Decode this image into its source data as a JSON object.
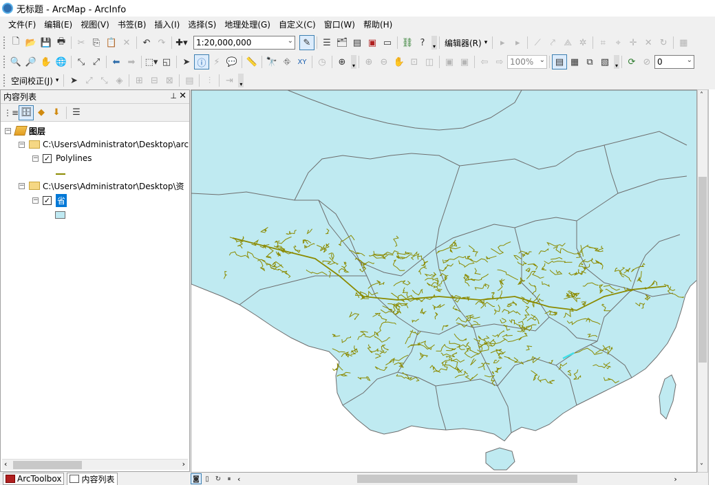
{
  "window": {
    "title": "无标题 - ArcMap - ArcInfo"
  },
  "menu": [
    "文件(F)",
    "编辑(E)",
    "视图(V)",
    "书签(B)",
    "插入(I)",
    "选择(S)",
    "地理处理(G)",
    "自定义(C)",
    "窗口(W)",
    "帮助(H)"
  ],
  "toolbar": {
    "scale": "1:20,000,000",
    "editor_label": "编辑器(R)",
    "zoom_percent": "100%",
    "layer_value": "0",
    "spatial_adjust_label": "空间校正(J)"
  },
  "toc": {
    "title": "内容列表",
    "root_label": "图层",
    "layer1_path": "C:\\Users\\Administrator\\Desktop\\arc",
    "layer1_name": "Polylines",
    "layer2_path": "C:\\Users\\Administrator\\Desktop\\资",
    "layer2_name": "省",
    "colors": {
      "polyline_symbol": "#8b8a00",
      "polygon_symbol": "#bfe9f2",
      "selected_layer_bg": "#0078d7"
    }
  },
  "bottom_tabs": [
    "ArcToolbox",
    "内容列表"
  ],
  "map": {
    "colors": {
      "province_fill": "#bfeaf1",
      "province_border": "#6d6d6d",
      "river": "#8b8a00",
      "river_highlight": "#40e0e8"
    }
  }
}
